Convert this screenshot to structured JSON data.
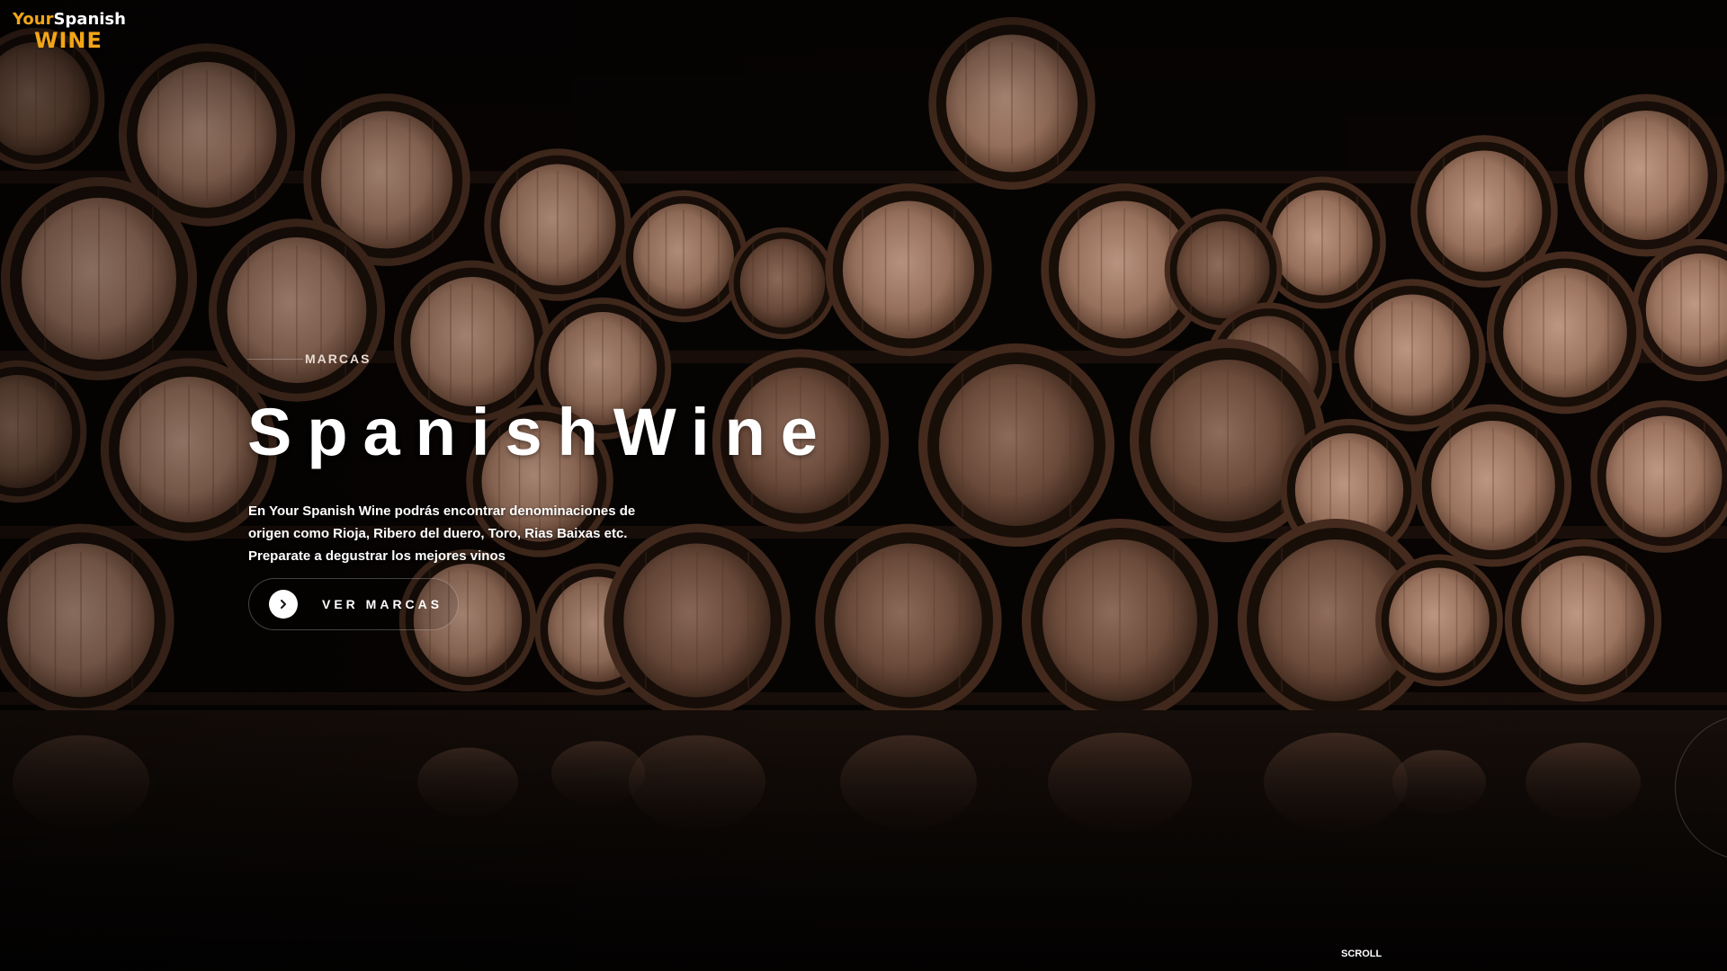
{
  "logo": {
    "line1_part1": "Your",
    "line1_part2": "Spanish",
    "line2": "WINE",
    "accent_color": "#f2a516"
  },
  "hero": {
    "eyebrow": "MARCAS",
    "title": "SpanishWine",
    "description": "En Your Spanish Wine podrás encontrar denominaciones de origen como Rioja, Ribero del duero, Toro, Rias Baixas etc. Preparate a degustrar los mejores vinos",
    "cta_label": "VER MARCAS",
    "cta_icon": "chevron-right-icon"
  },
  "scroll_label": "SCROLL",
  "background": {
    "subject": "wine barrels in a cellar",
    "colors": {
      "dark": "#050302",
      "wood": "#b98e78",
      "rim": "#3a2418"
    }
  }
}
